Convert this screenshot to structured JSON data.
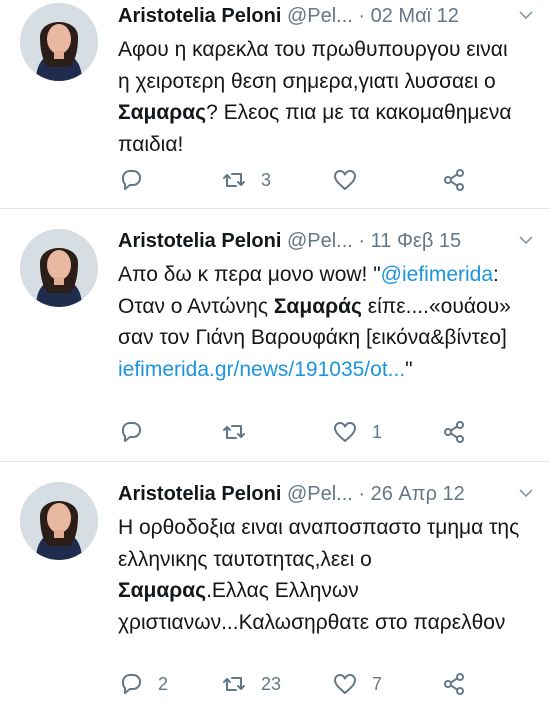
{
  "tweets": [
    {
      "name": "Aristotelia Peloni",
      "handle": "@Pel...",
      "dot": "·",
      "date": "02 Μαϊ 12",
      "text": [
        {
          "t": "Αφου η καρεκλα του πρωθυπουργου ειναι η χειροτερη θεση σημερα,γιατι λυσσαει ο "
        },
        {
          "b": "Σαμαρας"
        },
        {
          "t": "? Ελεος πια με τα κακομαθημενα παιδια!"
        }
      ],
      "replies": "",
      "retweets": "3",
      "likes": ""
    },
    {
      "name": "Aristotelia Peloni",
      "handle": "@Pel...",
      "dot": "·",
      "date": "11 Φεβ 15",
      "text": [
        {
          "t": "Απο δω κ περα μονο wow! \""
        },
        {
          "link": "@iefimerida"
        },
        {
          "t": ": Οταν ο Αντώνης "
        },
        {
          "b": "Σαμαράς"
        },
        {
          "t": " είπε....«ουάου» σαν τον Γιάνη Βαρουφάκη [εικόνα&βίντεο] "
        },
        {
          "link": "iefimerida.gr/news/191035/ot..."
        },
        {
          "t": "\""
        }
      ],
      "replies": "",
      "retweets": "",
      "likes": "1"
    },
    {
      "name": "Aristotelia Peloni",
      "handle": "@Pel...",
      "dot": "·",
      "date": "26 Απρ 12",
      "text": [
        {
          "t": "Η ορθοδοξια ειναι αναποσπαστο τμημα της ελληνικης ταυτοτητας,λεει ο "
        },
        {
          "b": "Σαμαρας"
        },
        {
          "t": ".Ελλας Ελληνων χριστιανων...Καλωσηρθατε στο παρελθον"
        }
      ],
      "replies": "2",
      "retweets": "23",
      "likes": "7"
    }
  ],
  "colors": {
    "text": "#14171a",
    "muted": "#657786",
    "link": "#1b95e0",
    "divider": "#e1e8ed"
  },
  "icons": {
    "reply": "reply-icon",
    "retweet": "retweet-icon",
    "like": "heart-icon",
    "share": "share-icon",
    "more": "chevron-down-icon"
  }
}
